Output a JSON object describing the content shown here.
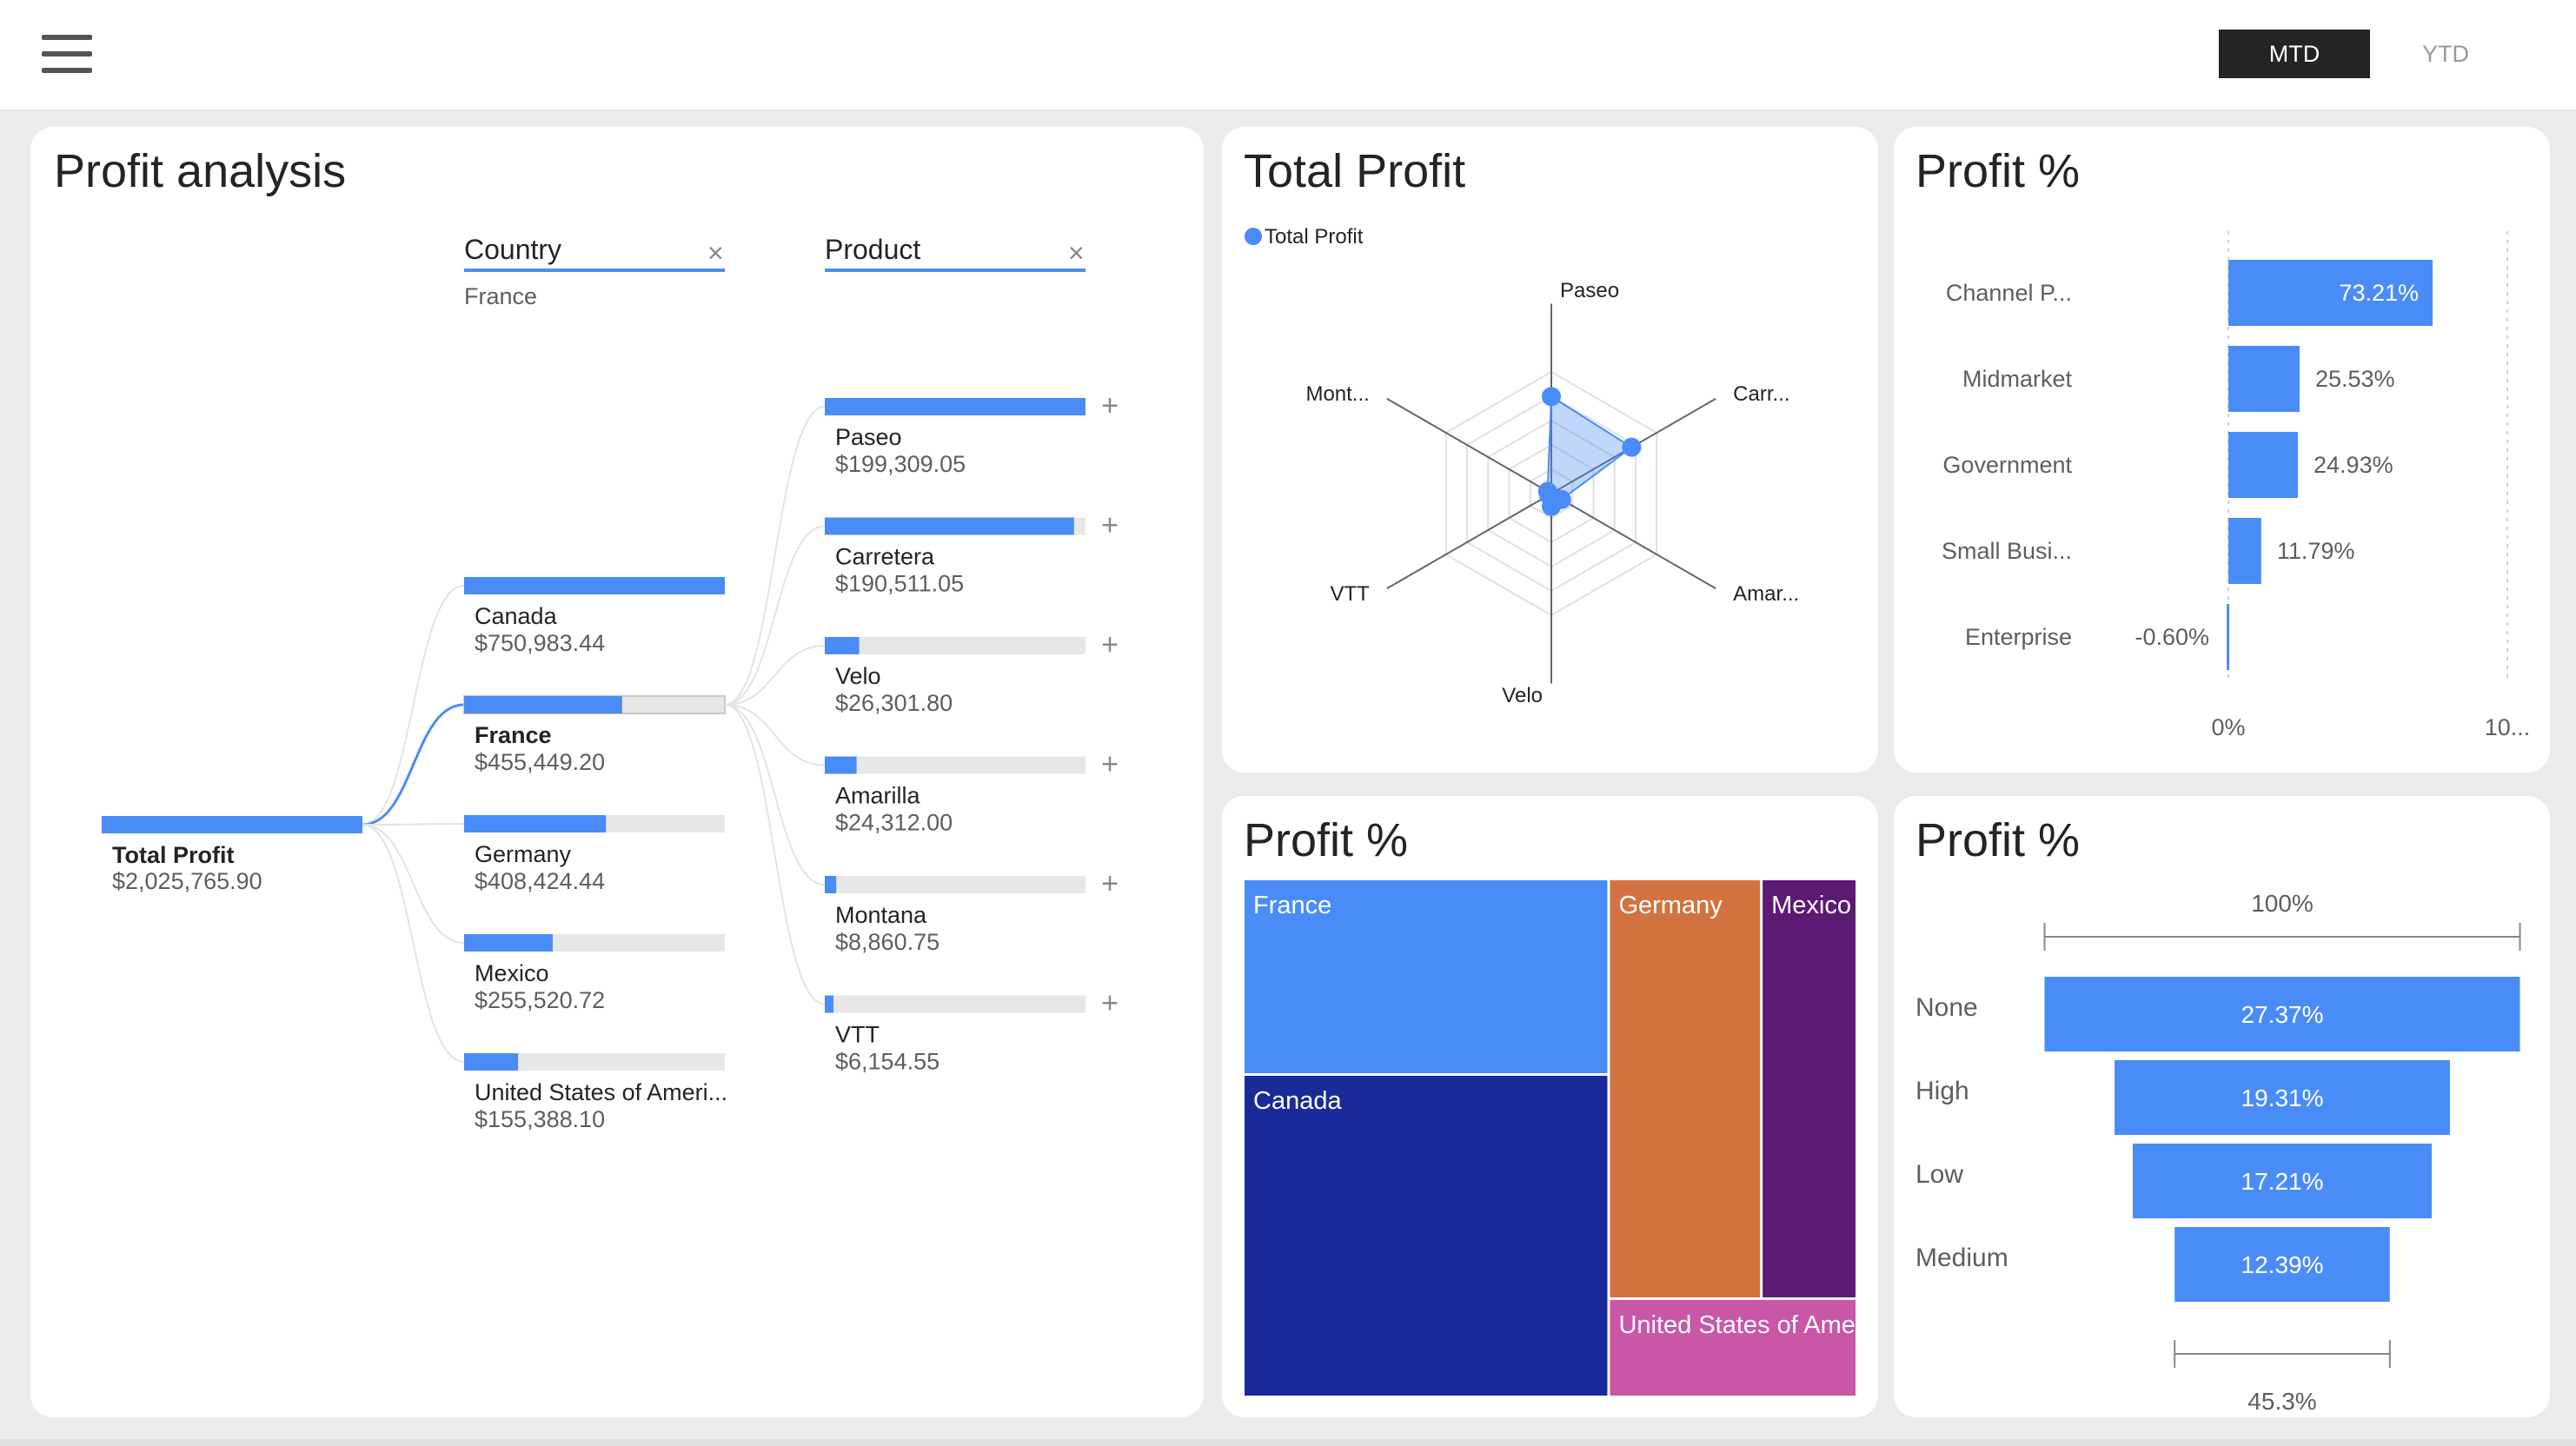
{
  "toolbar": {
    "menu_icon": "hamburger-menu-icon",
    "mtd_label": "MTD",
    "ytd_label": "YTD",
    "selected": "MTD"
  },
  "colors": {
    "accent": "#4a8cf7",
    "track": "#e7e7e7",
    "France": "#4a8cf7",
    "Canada": "#1a2a9b",
    "Germany": "#d2733f",
    "Mexico": "#5c1a75",
    "United States of America": "#c956a7"
  },
  "decomposition": {
    "title": "Profit analysis",
    "root": {
      "label": "Total Profit",
      "value": "$2,025,765.90"
    },
    "country_header": {
      "label": "Country",
      "filter": "France"
    },
    "product_header": {
      "label": "Product"
    },
    "countries": [
      {
        "label": "Canada",
        "value": "$750,983.44",
        "fill": 1.0
      },
      {
        "label": "France",
        "value": "$455,449.20",
        "fill": 0.606,
        "selected": true
      },
      {
        "label": "Germany",
        "value": "$408,424.44",
        "fill": 0.544
      },
      {
        "label": "Mexico",
        "value": "$255,520.72",
        "fill": 0.34
      },
      {
        "label": "United States of Ameri...",
        "value": "$155,388.10",
        "fill": 0.207
      }
    ],
    "products": [
      {
        "label": "Paseo",
        "value": "$199,309.05",
        "fill": 1.0
      },
      {
        "label": "Carretera",
        "value": "$190,511.05",
        "fill": 0.956
      },
      {
        "label": "Velo",
        "value": "$26,301.80",
        "fill": 0.132
      },
      {
        "label": "Amarilla",
        "value": "$24,312.00",
        "fill": 0.122
      },
      {
        "label": "Montana",
        "value": "$8,860.75",
        "fill": 0.044
      },
      {
        "label": "VTT",
        "value": "$6,154.55",
        "fill": 0.031
      }
    ]
  },
  "radar": {
    "title": "Total Profit",
    "legend": "Total Profit",
    "axes": [
      "Paseo",
      "Carr...",
      "Amar...",
      "Velo",
      "VTT",
      "Mont..."
    ],
    "chart_data": {
      "type": "radar",
      "categories": [
        "Paseo",
        "Carretera",
        "Amarilla",
        "Velo",
        "VTT",
        "Montana"
      ],
      "series": [
        {
          "name": "Total Profit",
          "values": [
            199309.05,
            190511.05,
            24312.0,
            26301.8,
            6154.55,
            8860.75
          ]
        }
      ],
      "max": 250000,
      "rings": 5
    }
  },
  "bars": {
    "title": "Profit %",
    "axis_min_label": "0%",
    "axis_max_label": "10...",
    "chart_data": {
      "type": "bar",
      "orientation": "horizontal",
      "categories": [
        "Channel P...",
        "Midmarket",
        "Government",
        "Small Busi...",
        "Enterprise"
      ],
      "values": [
        73.21,
        25.53,
        24.93,
        11.79,
        -0.6
      ],
      "labels": [
        "73.21%",
        "25.53%",
        "24.93%",
        "11.79%",
        "-0.60%"
      ],
      "xlim": [
        0,
        100
      ]
    }
  },
  "treemap": {
    "title": "Profit %",
    "chart_data": {
      "type": "treemap",
      "categories": [
        "France",
        "Canada",
        "Germany",
        "Mexico",
        "United States of America"
      ],
      "values": [
        22.48,
        37.07,
        20.16,
        12.61,
        7.67
      ]
    }
  },
  "funnel": {
    "title": "Profit %",
    "top_label": "100%",
    "bottom_label": "45.3%",
    "chart_data": {
      "type": "funnel",
      "categories": [
        "None",
        "High",
        "Low",
        "Medium"
      ],
      "values": [
        27.37,
        19.31,
        17.21,
        12.39
      ],
      "labels": [
        "27.37%",
        "19.31%",
        "17.21%",
        "12.39%"
      ]
    }
  }
}
